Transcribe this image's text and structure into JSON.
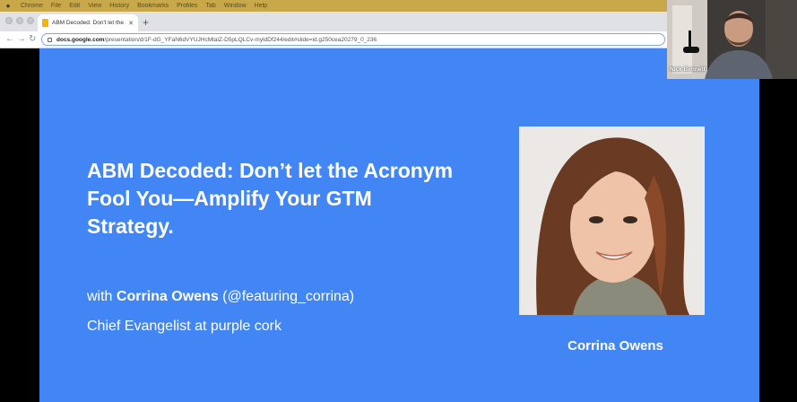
{
  "menubar": {
    "items": [
      "Chrome",
      "File",
      "Edit",
      "View",
      "History",
      "Bookmarks",
      "Profiles",
      "Tab",
      "Window",
      "Help"
    ]
  },
  "browser": {
    "tab_title": "ABM Decoded: Don't let the A...",
    "url_host": "docs.google.com",
    "url_path": "/presentation/d/1F-dG_YFaN6dVYUJHcMtalZ-D5pLQLCv-myldDf244/edit#slide=id.g250cea20279_0_236"
  },
  "slide": {
    "title": "ABM Decoded: Don’t let the Acronym Fool You—Amplify Your GTM Strategy.",
    "with_prefix": "with ",
    "speaker_name": "Corrina Owens",
    "speaker_handle": " (@featuring_corrina)",
    "speaker_role": "Chief Evangelist at purple cork",
    "photo_caption": "Corrina Owens",
    "background_color": "#4285f4"
  },
  "webcam": {
    "name": "Nick Bennett"
  }
}
